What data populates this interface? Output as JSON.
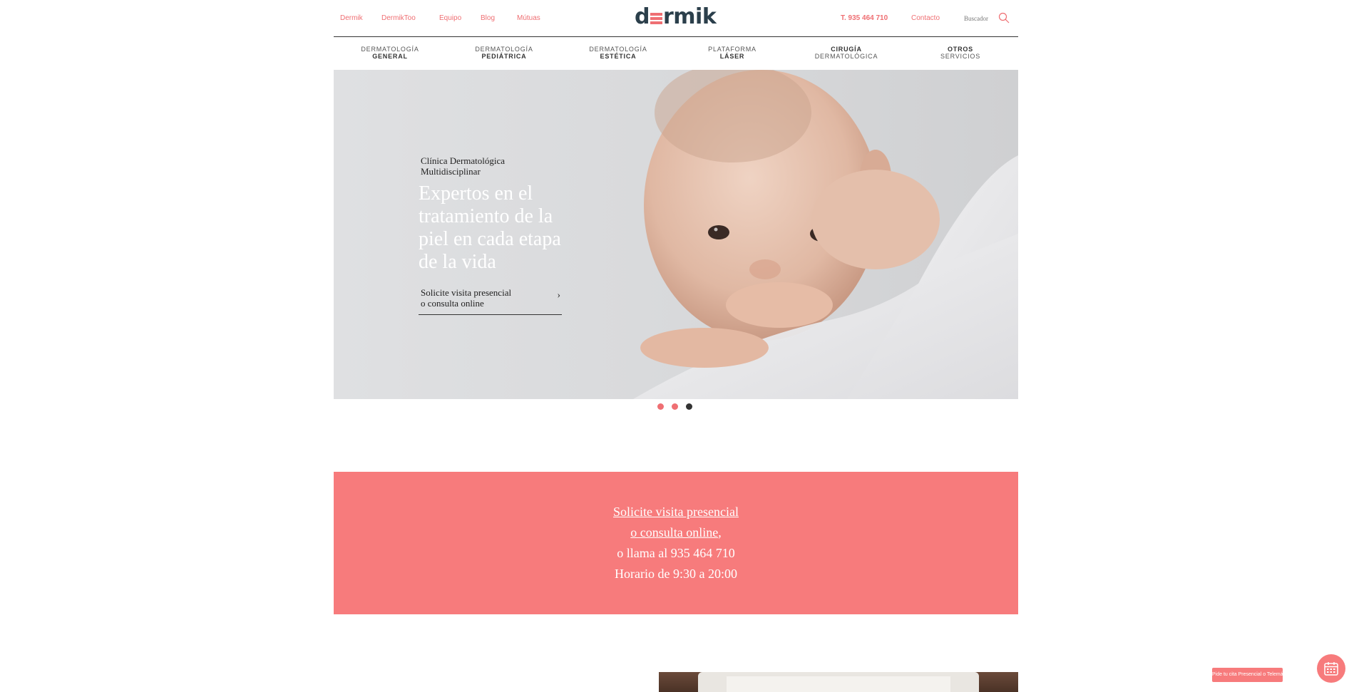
{
  "header": {
    "links": [
      {
        "label": "Dermik"
      },
      {
        "label": "DermikToo"
      },
      {
        "label": "Equipo"
      },
      {
        "label": "Blog"
      },
      {
        "label": "Mútuas"
      }
    ],
    "logo_left": "d",
    "logo_right": "rmik",
    "phone": "T. 935 464 710",
    "contact": "Contacto",
    "search_label": "Buscador",
    "accent_color": "#ef6f73",
    "logo_color": "#2b3f4b"
  },
  "mainnav": [
    {
      "l1": "DERMATOLOGÍA",
      "l2": "GENERAL"
    },
    {
      "l1": "DERMATOLOGÍA",
      "l2": "PEDIÁTRICA"
    },
    {
      "l1": "DERMATOLOGÍA",
      "l2": "ESTÉTICA"
    },
    {
      "l1": "PLATAFORMA",
      "l2": "LÁSER"
    },
    {
      "l1": "CIRUGÍA",
      "l2": "DERMATOLÓGICA"
    },
    {
      "l1": "OTROS",
      "l2": "SERVICIOS"
    }
  ],
  "hero": {
    "subtitle_l1": "Clínica Dermatológica",
    "subtitle_l2": "Multidisciplinar",
    "title": "Expertos en el tratamiento de la piel en cada etapa de la vida",
    "cta_l1": "Solicite visita presencial",
    "cta_l2": "o consulta online",
    "slides": 3,
    "active_slide": 3
  },
  "banner": {
    "link_l1": "Solicite visita presencial",
    "link_l2": "o consulta online",
    "after_link": ",",
    "phone_line": "o llama al 935 464 710",
    "hours_line": "Horario de 9:30 a 20:00",
    "color": "#f77b7c"
  },
  "floating": {
    "appointment_label": "Pide tu cita Presencial o Telemática",
    "calendar_icon": "calendar-icon"
  }
}
